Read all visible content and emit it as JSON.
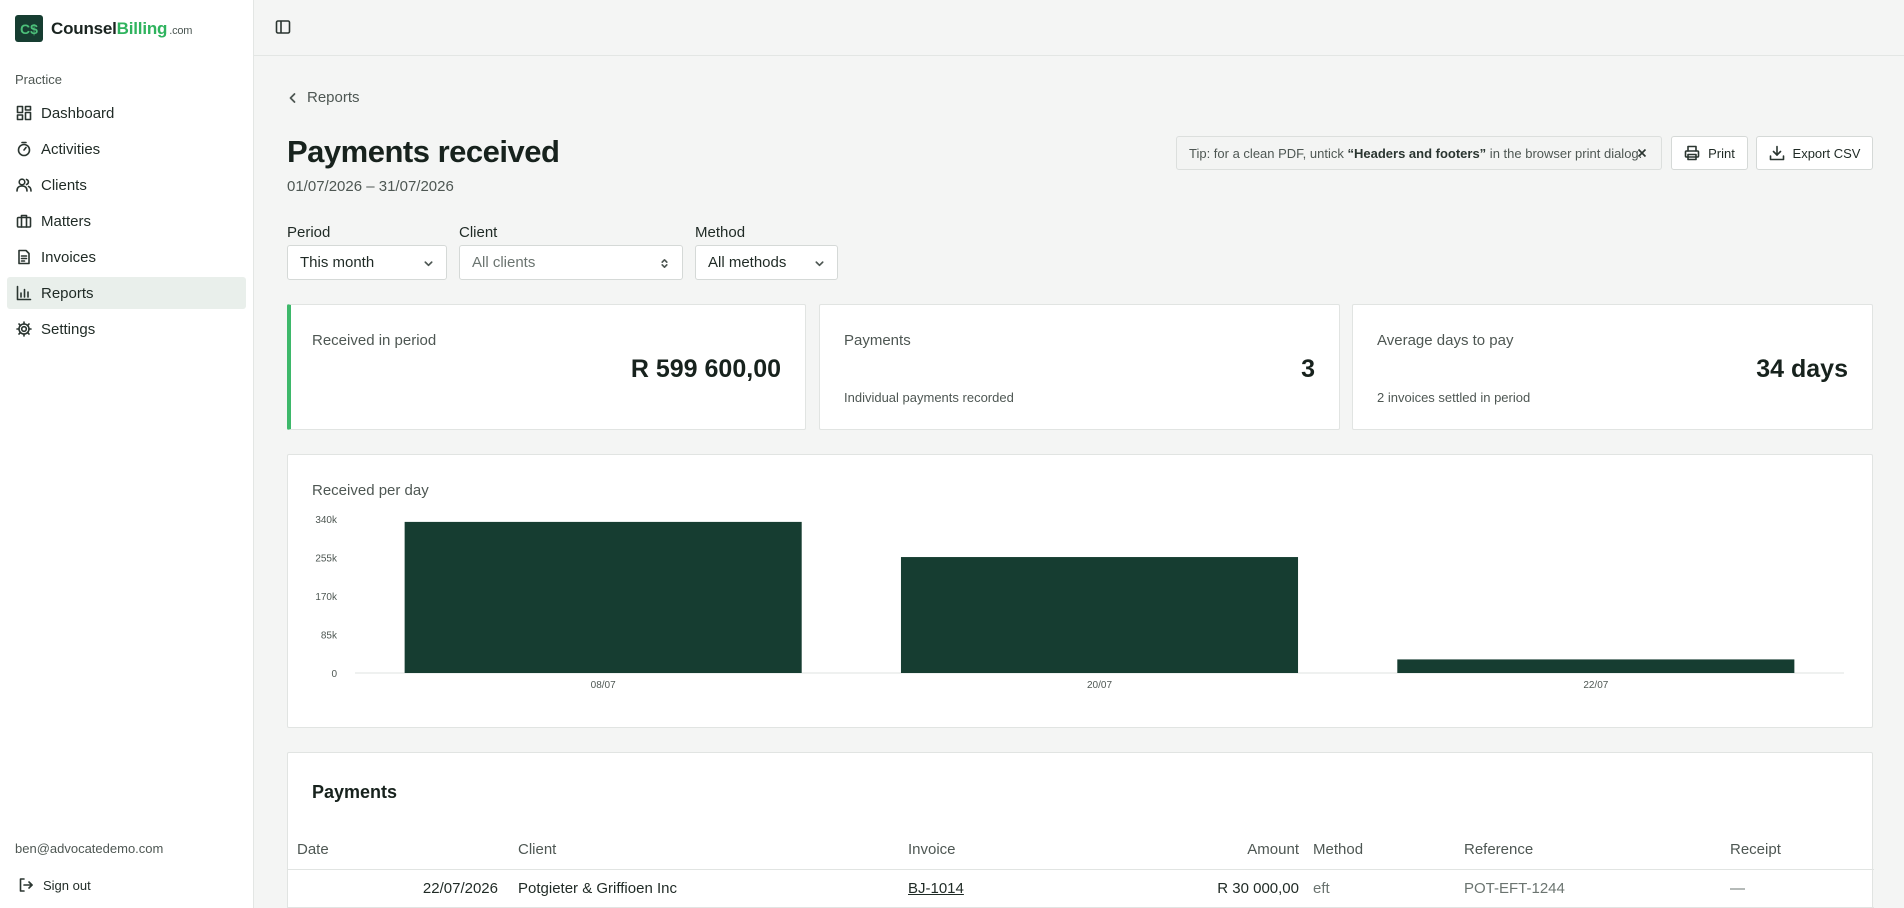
{
  "brand": {
    "logo_glyph": "C$",
    "name_part1": "Counsel",
    "name_part2": "Billing",
    "tld": ".com",
    "accent_color": "#2fb35e",
    "logo_bg": "#163d31"
  },
  "sidebar": {
    "section_label": "Practice",
    "items": [
      {
        "label": "Dashboard",
        "icon": "dashboard-icon",
        "active": false
      },
      {
        "label": "Activities",
        "icon": "timer-icon",
        "active": false
      },
      {
        "label": "Clients",
        "icon": "users-icon",
        "active": false
      },
      {
        "label": "Matters",
        "icon": "briefcase-icon",
        "active": false
      },
      {
        "label": "Invoices",
        "icon": "document-icon",
        "active": false
      },
      {
        "label": "Reports",
        "icon": "bar-chart-icon",
        "active": true
      },
      {
        "label": "Settings",
        "icon": "gear-icon",
        "active": false
      }
    ],
    "user_email": "ben@advocatedemo.com",
    "sign_out_label": "Sign out"
  },
  "header": {
    "back_label": "Reports",
    "title": "Payments received",
    "date_range": "01/07/2026 – 31/07/2026",
    "tip_prefix": "Tip: for a clean PDF, untick ",
    "tip_bold": "“Headers and footers”",
    "tip_suffix": " in the browser print dialog.",
    "print_label": "Print",
    "export_label": "Export CSV"
  },
  "filters": {
    "period": {
      "label": "Period",
      "value": "This month"
    },
    "client": {
      "label": "Client",
      "placeholder": "All clients"
    },
    "method": {
      "label": "Method",
      "value": "All methods"
    }
  },
  "kpis": [
    {
      "label": "Received in period",
      "value": "R 599 600,00",
      "sub": ""
    },
    {
      "label": "Payments",
      "value": "3",
      "sub": "Individual payments recorded"
    },
    {
      "label": "Average days to pay",
      "value": "34 days",
      "sub": "2 invoices settled in period"
    }
  ],
  "chart": {
    "title": "Received per day"
  },
  "chart_data": {
    "type": "bar",
    "title": "Received per day",
    "categories": [
      "08/07",
      "20/07",
      "22/07"
    ],
    "values": [
      333600,
      256000,
      30000
    ],
    "ylim": [
      0,
      340000
    ],
    "yticks": [
      0,
      85000,
      170000,
      255000,
      340000
    ],
    "ytick_labels": [
      "0",
      "85k",
      "170k",
      "255k",
      "340k"
    ],
    "bar_color": "#163d31",
    "grid": false
  },
  "table": {
    "title": "Payments",
    "columns": [
      "Date",
      "Client",
      "Invoice",
      "Amount",
      "Method",
      "Reference",
      "Receipt"
    ],
    "rows": [
      {
        "date": "22/07/2026",
        "client": "Potgieter & Griffioen Inc",
        "invoice": "BJ-1014",
        "amount": "R 30 000,00",
        "method": "eft",
        "reference": "POT-EFT-1244",
        "receipt": "—"
      }
    ]
  }
}
